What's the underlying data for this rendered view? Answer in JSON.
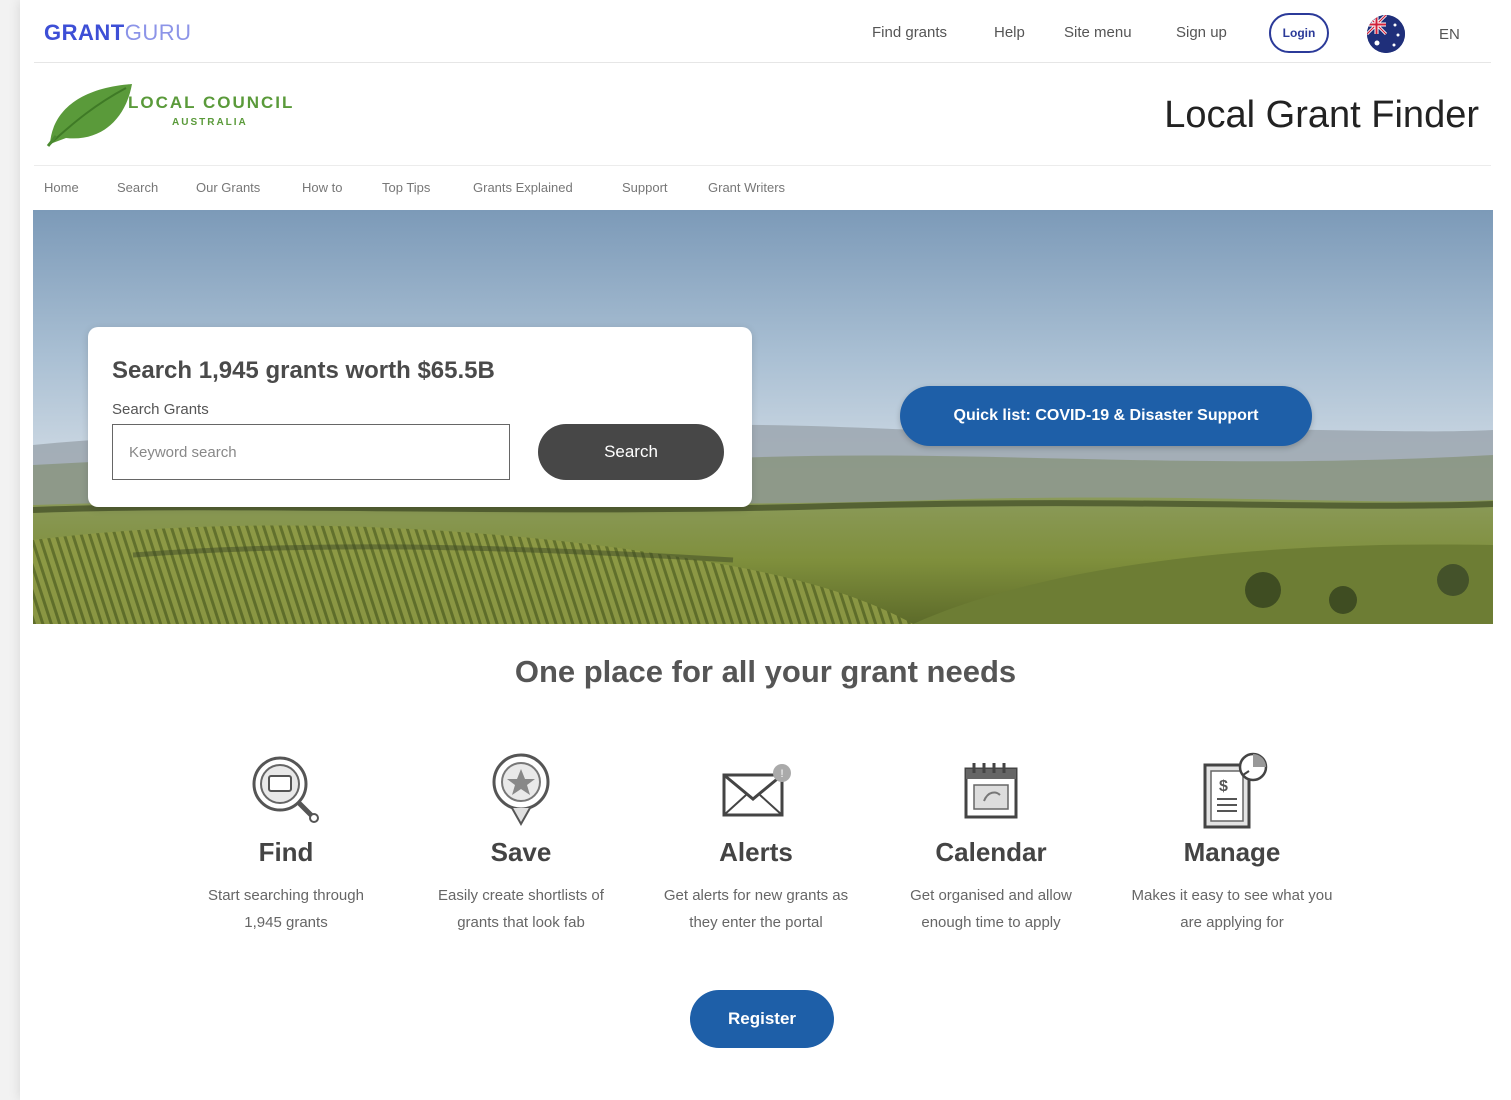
{
  "topbar": {
    "brand_primary": "GRANT",
    "brand_secondary": "GURU",
    "nav": [
      "Find grants",
      "Help",
      "Site menu",
      "Sign up"
    ],
    "login_label": "Login",
    "flag_icon": "australia-flag-icon",
    "language": "EN"
  },
  "header": {
    "org_name": "LOCAL COUNCIL",
    "org_sub": "AUSTRALIA",
    "page_title": "Local Grant Finder",
    "nav": [
      "Home",
      "Search",
      "Our Grants",
      "How to",
      "Top Tips",
      "Grants Explained",
      "Support",
      "Grant Writers"
    ]
  },
  "hero": {
    "heading": "Search 1,945 grants worth $65.5B",
    "search_label": "Search Grants",
    "search_placeholder": "Keyword search",
    "search_value": "",
    "search_button": "Search",
    "quick_list_button": "Quick list: COVID-19 & Disaster Support"
  },
  "features": {
    "tagline": "One place for all your grant needs",
    "items": [
      {
        "title": "Find",
        "line1": "Start searching through",
        "line2": "1,945 grants",
        "icon": "magnifier-icon"
      },
      {
        "title": "Save",
        "line1": "Easily create shortlists of",
        "line2": "grants that look fab",
        "icon": "star-pin-icon"
      },
      {
        "title": "Alerts",
        "line1": "Get alerts for new grants as",
        "line2": "they enter the portal",
        "icon": "envelope-icon"
      },
      {
        "title": "Calendar",
        "line1": "Get organised and allow",
        "line2": "enough time to apply",
        "icon": "calendar-icon"
      },
      {
        "title": "Manage",
        "line1": "Makes it easy to see what you",
        "line2": "are applying for",
        "icon": "document-chart-icon"
      }
    ]
  },
  "register_button": "Register",
  "colors": {
    "brand_blue": "#3d4fd6",
    "button_blue": "#1e5fa8",
    "leaf_green": "#5a9a3a",
    "search_button": "#474747"
  }
}
